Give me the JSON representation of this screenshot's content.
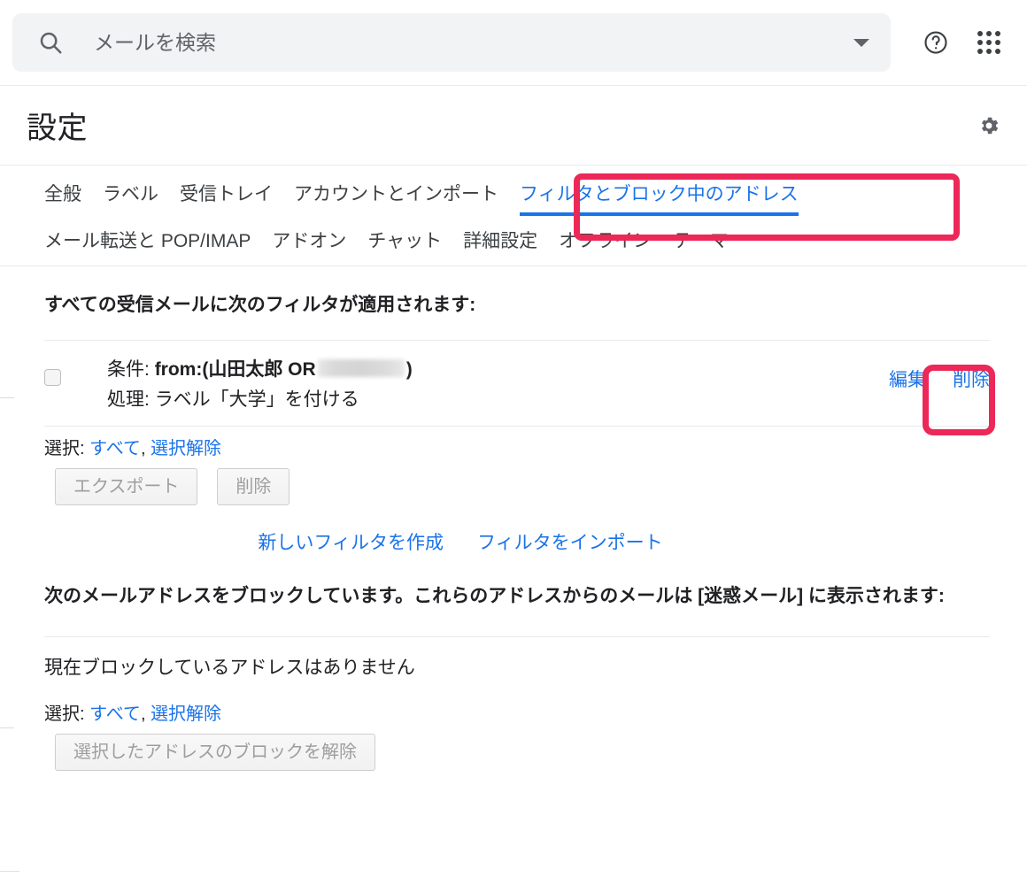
{
  "search": {
    "placeholder": "メールを検索",
    "value": "",
    "icon": "search-icon",
    "dropdown_icon": "chevron-down-icon"
  },
  "topbar": {
    "help_icon": "help-circle-icon",
    "apps_icon": "apps-grid-icon"
  },
  "header": {
    "title": "設定",
    "gear_icon": "gear-icon"
  },
  "tabs": {
    "row1": [
      {
        "label": "全般",
        "active": false
      },
      {
        "label": "ラベル",
        "active": false
      },
      {
        "label": "受信トレイ",
        "active": false
      },
      {
        "label": "アカウントとインポート",
        "active": false
      },
      {
        "label": "フィルタとブロック中のアドレス",
        "active": true
      }
    ],
    "row2": [
      {
        "label": "メール転送と POP/IMAP",
        "active": false
      },
      {
        "label": "アドオン",
        "active": false
      },
      {
        "label": "チャット",
        "active": false
      },
      {
        "label": "詳細設定",
        "active": false
      },
      {
        "label": "オフライン",
        "active": false
      },
      {
        "label": "テーマ",
        "active": false
      }
    ]
  },
  "filters_section": {
    "heading": "すべての受信メールに次のフィルタが適用されます:",
    "rows": [
      {
        "criteria_label": "条件:",
        "criteria_value_prefix": "from:(山田太郎 OR",
        "criteria_value_suffix": ")",
        "criteria_redacted": true,
        "action_label": "処理:",
        "action_value": "ラベル「大学」を付ける",
        "edit_label": "編集",
        "delete_label": "削除"
      }
    ],
    "select_prefix": "選択:",
    "select_all_label": "すべて",
    "select_separator": ",",
    "select_none_label": "選択解除",
    "export_button": "エクスポート",
    "delete_button": "削除",
    "create_filter_link": "新しいフィルタを作成",
    "import_filter_link": "フィルタをインポート"
  },
  "blocked_section": {
    "heading": "次のメールアドレスをブロックしています。これらのアドレスからのメールは [迷惑メール] に表示されます:",
    "empty_message": "現在ブロックしているアドレスはありません",
    "select_prefix": "選択:",
    "select_all_label": "すべて",
    "select_separator": ",",
    "select_none_label": "選択解除",
    "unblock_button": "選択したアドレスのブロックを解除"
  },
  "annotations": {
    "color": "#ec2859",
    "boxes": [
      {
        "target": "フィルタとブロック中のアドレス"
      },
      {
        "target": "削除"
      }
    ]
  },
  "colors": {
    "link_blue": "#1a73e8",
    "text_primary": "#202124",
    "search_bg": "#f1f3f4",
    "annotation_pink": "#ec2859"
  }
}
